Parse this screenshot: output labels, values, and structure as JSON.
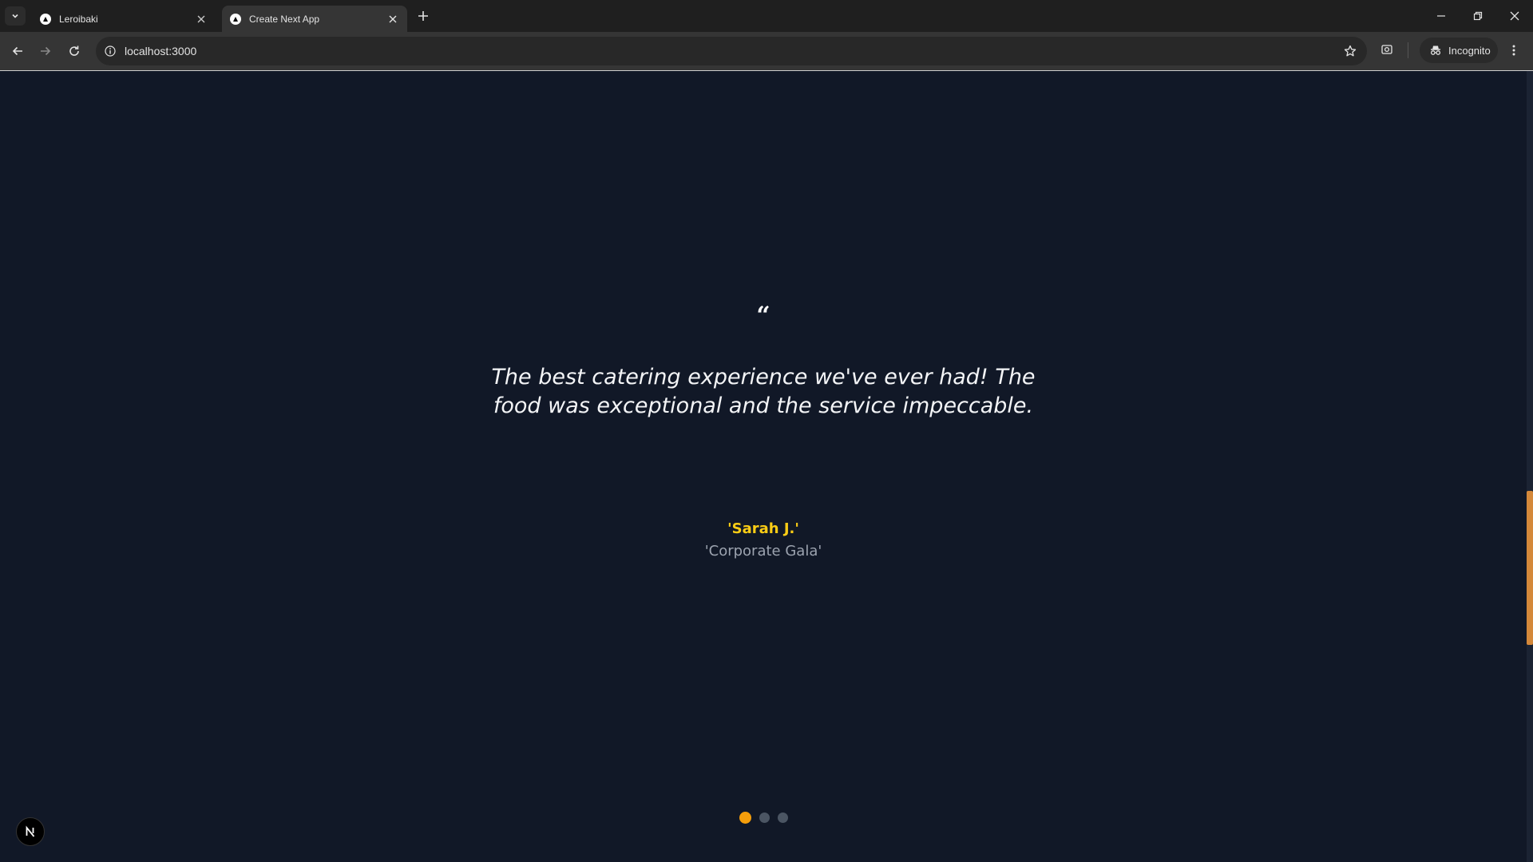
{
  "browser": {
    "tabs": [
      {
        "title": "Leroibaki",
        "active": false
      },
      {
        "title": "Create Next App",
        "active": true
      }
    ],
    "url": "localhost:3000",
    "incognito_label": "Incognito"
  },
  "testimonial": {
    "quote_mark": "“",
    "text": "The best catering experience we've ever had! The food was exceptional and the service impeccable.",
    "author": "'Sarah J.'",
    "event": "'Corporate Gala'"
  },
  "carousel": {
    "slide_count": 3,
    "active_index": 0
  },
  "dev_badge": {
    "letter": "N"
  },
  "colors": {
    "page_background": "#111827",
    "author": "#facc15",
    "event": "#9ca3af",
    "active_dot": "#f59e0b",
    "inactive_dot": "#4b5563",
    "scrollbar_thumb": "#d4883a"
  },
  "icons": {
    "tab_list": "chevron-down-icon",
    "tab_close": "close-icon",
    "new_tab": "plus-icon",
    "back": "arrow-left-icon",
    "forward": "arrow-right-icon",
    "reload": "reload-icon",
    "site_info": "info-icon",
    "bookmark": "star-icon",
    "incognito": "incognito-icon",
    "menu": "more-vert-icon"
  }
}
